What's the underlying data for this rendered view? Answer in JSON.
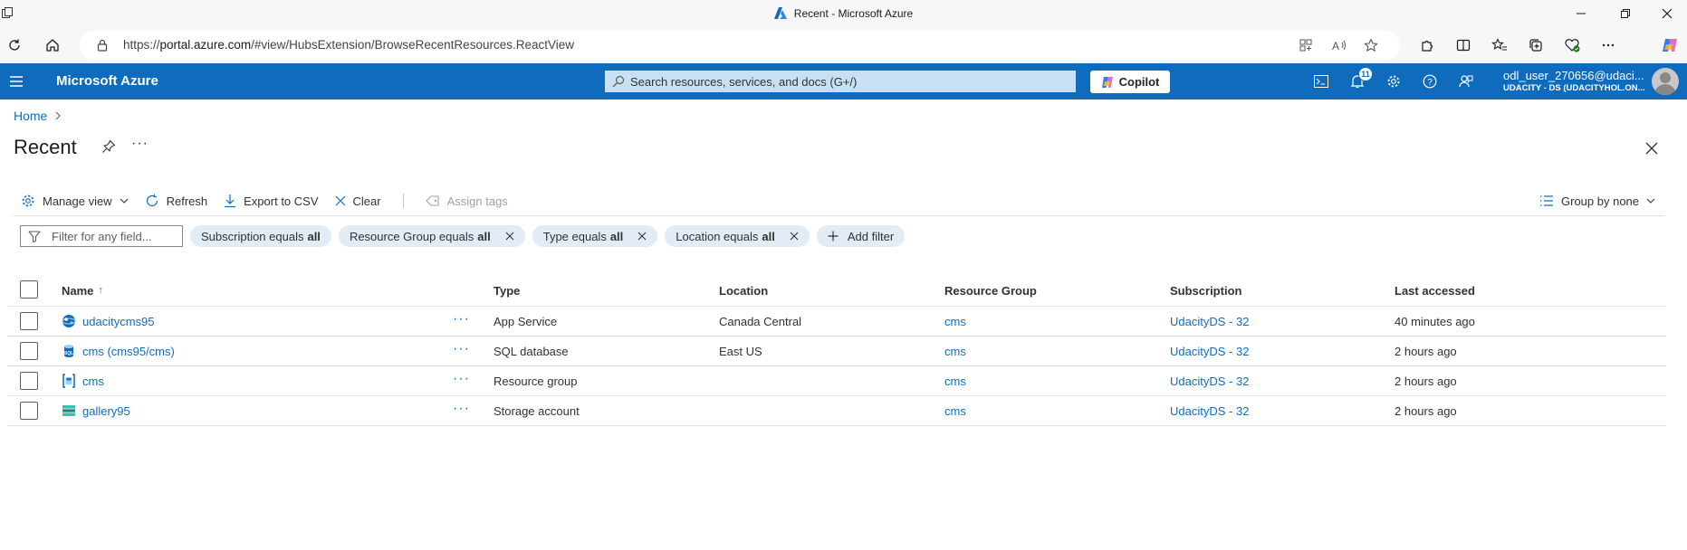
{
  "window": {
    "title": "Recent - Microsoft Azure"
  },
  "browser": {
    "url_prefix": "https://",
    "url_domain": "portal.azure.com",
    "url_path": "/#view/HubsExtension/BrowseRecentResources.ReactView"
  },
  "header": {
    "brand": "Microsoft Azure",
    "search_placeholder": "Search resources, services, and docs (G+/)",
    "copilot_label": "Copilot",
    "notification_count": "11",
    "account_user": "odl_user_270656@udaci...",
    "account_tenant": "UDACITY - DS (UDACITYHOL.ON..."
  },
  "breadcrumb": {
    "home": "Home"
  },
  "page": {
    "title": "Recent"
  },
  "commands": {
    "manage_view": "Manage view",
    "refresh": "Refresh",
    "export": "Export to CSV",
    "clear": "Clear",
    "assign_tags": "Assign tags",
    "group_by": "Group by none"
  },
  "filters": {
    "placeholder": "Filter for any field...",
    "pills": [
      {
        "field": "Subscription equals",
        "value": "all"
      },
      {
        "field": "Resource Group equals",
        "value": "all"
      },
      {
        "field": "Type equals",
        "value": "all"
      },
      {
        "field": "Location equals",
        "value": "all"
      }
    ],
    "add_filter": "Add filter"
  },
  "table": {
    "columns": {
      "name": "Name",
      "sort_indicator": "↑",
      "type": "Type",
      "location": "Location",
      "resource_group": "Resource Group",
      "subscription": "Subscription",
      "last_accessed": "Last accessed"
    },
    "rows": [
      {
        "name": "udacitycms95",
        "icon": "app-service-icon",
        "type": "App Service",
        "location": "Canada Central",
        "resource_group": "cms",
        "subscription": "UdacityDS - 32",
        "last_accessed": "40 minutes ago"
      },
      {
        "name": "cms (cms95/cms)",
        "icon": "sql-database-icon",
        "type": "SQL database",
        "location": "East US",
        "resource_group": "cms",
        "subscription": "UdacityDS - 32",
        "last_accessed": "2 hours ago"
      },
      {
        "name": "cms",
        "icon": "resource-group-icon",
        "type": "Resource group",
        "location": "",
        "resource_group": "cms",
        "subscription": "UdacityDS - 32",
        "last_accessed": "2 hours ago"
      },
      {
        "name": "gallery95",
        "icon": "storage-account-icon",
        "type": "Storage account",
        "location": "",
        "resource_group": "cms",
        "subscription": "UdacityDS - 32",
        "last_accessed": "2 hours ago"
      }
    ]
  },
  "colors": {
    "azure_blue": "#0f6cbd",
    "pill_bg": "#e1ecf7",
    "search_bg": "#c7e0f4"
  }
}
